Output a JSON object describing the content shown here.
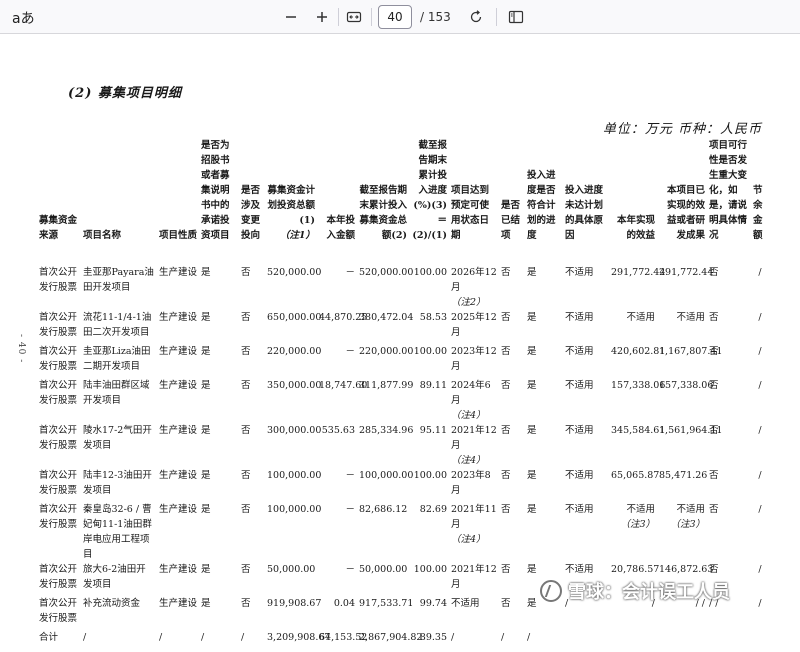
{
  "toolbar": {
    "text_tool_label": "aあ",
    "current_page": "40",
    "total_pages": "/ 153"
  },
  "doc": {
    "section_title": "(2)  募集项目明细",
    "unit_line": "单位：万元   币种：人民币",
    "page_marker": "- 40 -",
    "headers": [
      "募集资金来源",
      "项目名称",
      "项目性质",
      "是否为招股书或者募集说明书中的承诺投资项目",
      "是否涉及变更投向",
      "募集资金计划投资总额(1)",
      "（注1）",
      "本年投入金额",
      "截至报告期末累计投入募集资金总额(2)",
      "截至报告期末累计投入进度(%)(3)＝(2)/(1)",
      "项目达到预定可使用状态日期",
      "是否已结项",
      "投入进度是否符合计划的进度",
      "投入进度未达计划的具体原因",
      "本年实现的效益",
      "本项目已实现的效益或者研发成果",
      "项目可行性是否发生重大变化，如是，请说明具体情况",
      "节余金额"
    ],
    "rows": [
      {
        "source": "首次公开发行股票",
        "name": "圭亚那Payara油田开发项目",
        "nature": "生产建设",
        "promised": "是",
        "changed": "否",
        "plan": "520,000.00",
        "year": "－",
        "cum": "520,000.00",
        "progress": "100.00",
        "date": "2026年12月",
        "date_note": "（注2）",
        "closed": "否",
        "on_plan": "是",
        "reason": "不适用",
        "benefit": "291,772.44",
        "total_benefit": "291,772.44",
        "tb_note": "",
        "feasible": "否",
        "surplus": "/"
      },
      {
        "source": "首次公开发行股票",
        "name": "流花11-1/4-1油田二次开发项目",
        "nature": "生产建设",
        "promised": "是",
        "changed": "否",
        "plan": "650,000.00",
        "year": "44,870.25",
        "cum": "380,472.04",
        "progress": "58.53",
        "date": "2025年12月",
        "date_note": "",
        "closed": "否",
        "on_plan": "是",
        "reason": "不适用",
        "benefit": "不适用",
        "total_benefit": "不适用",
        "tb_note": "",
        "feasible": "否",
        "surplus": "/"
      },
      {
        "source": "首次公开发行股票",
        "name": "圭亚那Liza油田二期开发项目",
        "nature": "生产建设",
        "promised": "是",
        "changed": "否",
        "plan": "220,000.00",
        "year": "－",
        "cum": "220,000.00",
        "progress": "100.00",
        "date": "2023年12月",
        "date_note": "",
        "closed": "否",
        "on_plan": "是",
        "reason": "不适用",
        "benefit": "420,602.81",
        "total_benefit": "1,167,807.41",
        "tb_note": "",
        "feasible": "否",
        "surplus": "/"
      },
      {
        "source": "首次公开发行股票",
        "name": "陆丰油田群区域开发项目",
        "nature": "生产建设",
        "promised": "是",
        "changed": "否",
        "plan": "350,000.00",
        "year": "18,747.60",
        "cum": "311,877.99",
        "progress": "89.11",
        "date": "2024年6月",
        "date_note": "（注4）",
        "closed": "否",
        "on_plan": "是",
        "reason": "不适用",
        "benefit": "157,338.06",
        "total_benefit": "157,338.06",
        "tb_note": "",
        "feasible": "否",
        "surplus": "/"
      },
      {
        "source": "首次公开发行股票",
        "name": "陵水17-2气田开发项目",
        "nature": "生产建设",
        "promised": "是",
        "changed": "否",
        "plan": "300,000.00",
        "year": "535.63",
        "cum": "285,334.96",
        "progress": "95.11",
        "date": "2021年12月",
        "date_note": "（注4）",
        "closed": "否",
        "on_plan": "是",
        "reason": "不适用",
        "benefit": "345,584.61",
        "total_benefit": "1,561,964.11",
        "tb_note": "",
        "feasible": "否",
        "surplus": "/"
      },
      {
        "source": "首次公开发行股票",
        "name": "陆丰12-3油田开发项目",
        "nature": "生产建设",
        "promised": "是",
        "changed": "否",
        "plan": "100,000.00",
        "year": "－",
        "cum": "100,000.00",
        "progress": "100.00",
        "date": "2023年8月",
        "date_note": "",
        "closed": "否",
        "on_plan": "是",
        "reason": "不适用",
        "benefit": "65,065.87",
        "total_benefit": "85,471.26",
        "tb_note": "",
        "feasible": "否",
        "surplus": "/"
      },
      {
        "source": "首次公开发行股票",
        "name": "秦皇岛32-6 / 曹妃甸11-1油田群岸电应用工程项目",
        "nature": "生产建设",
        "promised": "是",
        "changed": "否",
        "plan": "100,000.00",
        "year": "－",
        "cum": "82,686.12",
        "progress": "82.69",
        "date": "2021年11月",
        "date_note": "（注4）",
        "closed": "否",
        "on_plan": "是",
        "reason": "不适用",
        "benefit": "不适用",
        "benefit_note": "（注3）",
        "total_benefit": "不适用",
        "tb_note": "（注3）",
        "feasible": "否",
        "surplus": "/"
      },
      {
        "source": "首次公开发行股票",
        "name": "旅大6-2油田开发项目",
        "nature": "生产建设",
        "promised": "是",
        "changed": "否",
        "plan": "50,000.00",
        "year": "－",
        "cum": "50,000.00",
        "progress": "100.00",
        "date": "2021年12月",
        "date_note": "",
        "closed": "否",
        "on_plan": "是",
        "reason": "不适用",
        "benefit": "20,786.57",
        "total_benefit": "146,872.63",
        "tb_note": "",
        "feasible": "否",
        "surplus": "/"
      },
      {
        "source": "首次公开发行股票",
        "name": "补充流动资金",
        "nature": "生产建设",
        "promised": "是",
        "changed": "否",
        "plan": "919,908.67",
        "year": "0.04",
        "cum": "917,533.71",
        "progress": "99.74",
        "date": "不适用",
        "date_note": "",
        "closed": "否",
        "on_plan": "是",
        "reason": "/",
        "benefit": "/",
        "total_benefit": "/ /",
        "tb_note": "",
        "feasible": "/ /",
        "surplus": "/"
      }
    ],
    "total": {
      "label": "合计",
      "name": "/",
      "nature": "/",
      "promised": "/",
      "changed": "/",
      "plan": "3,209,908.67",
      "year": "64,153.52",
      "cum": "2,867,904.82",
      "progress": "89.35",
      "date": "/",
      "closed": "/",
      "on_plan": "/"
    }
  },
  "watermark": {
    "text": "雪球：会计误工人员"
  }
}
